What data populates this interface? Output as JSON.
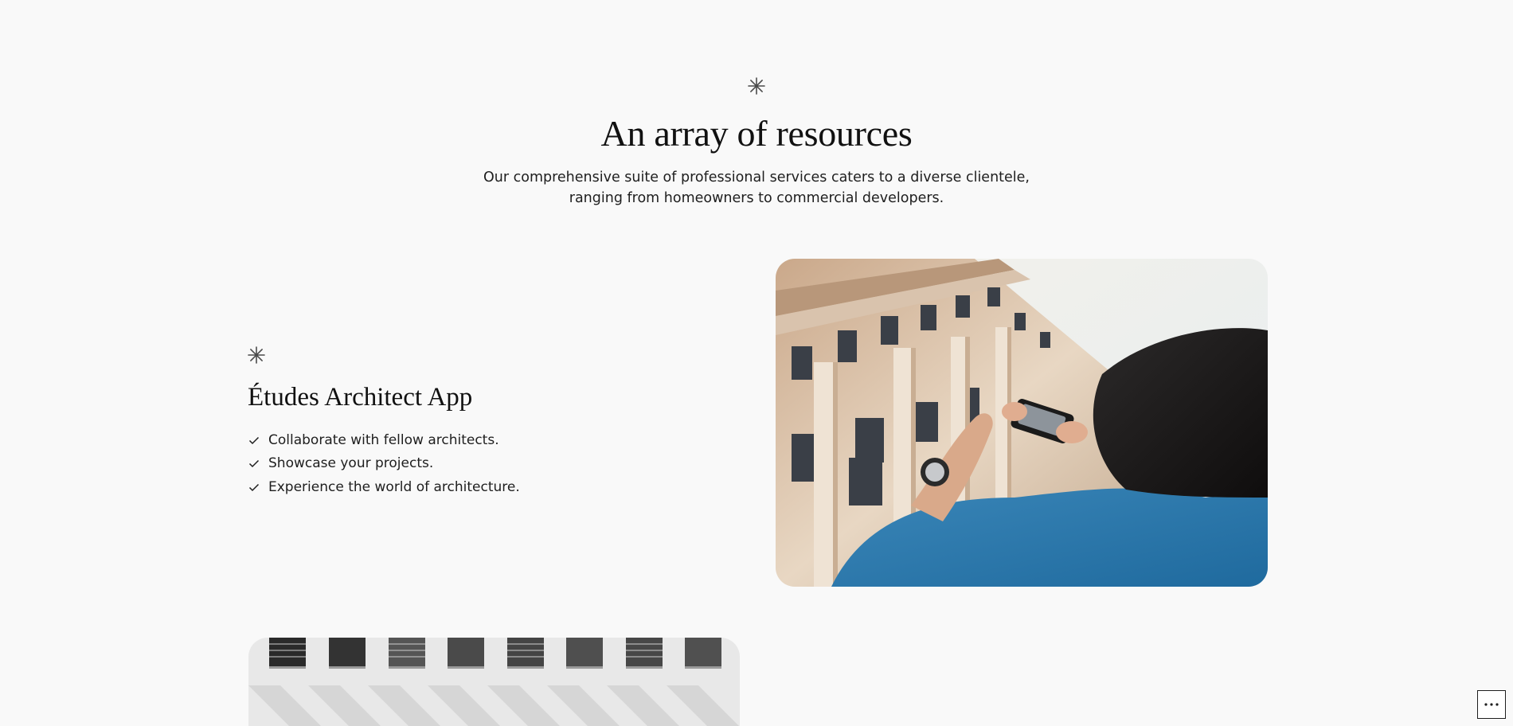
{
  "header": {
    "icon": "asterisk-icon",
    "title": "An array of resources",
    "intro_line_1": "Our comprehensive suite of professional services caters to a diverse clientele,",
    "intro_line_2": "ranging from homeowners to commercial developers."
  },
  "feature": {
    "icon": "asterisk-icon",
    "title": "Études Architect App",
    "items": [
      {
        "icon": "check-icon",
        "label": "Collaborate with fellow architects."
      },
      {
        "icon": "check-icon",
        "label": "Showcase your projects."
      },
      {
        "icon": "check-icon",
        "label": "Experience the world of architecture."
      }
    ]
  },
  "images": {
    "building_photo": "woman-photographing-building-image",
    "facade_photo": "white-facade-windows-image"
  },
  "options_button": {
    "icon": "more-dots-icon"
  },
  "colors": {
    "background": "#f9f9f9",
    "text": "#111111",
    "body_text": "#1e1e1e"
  }
}
